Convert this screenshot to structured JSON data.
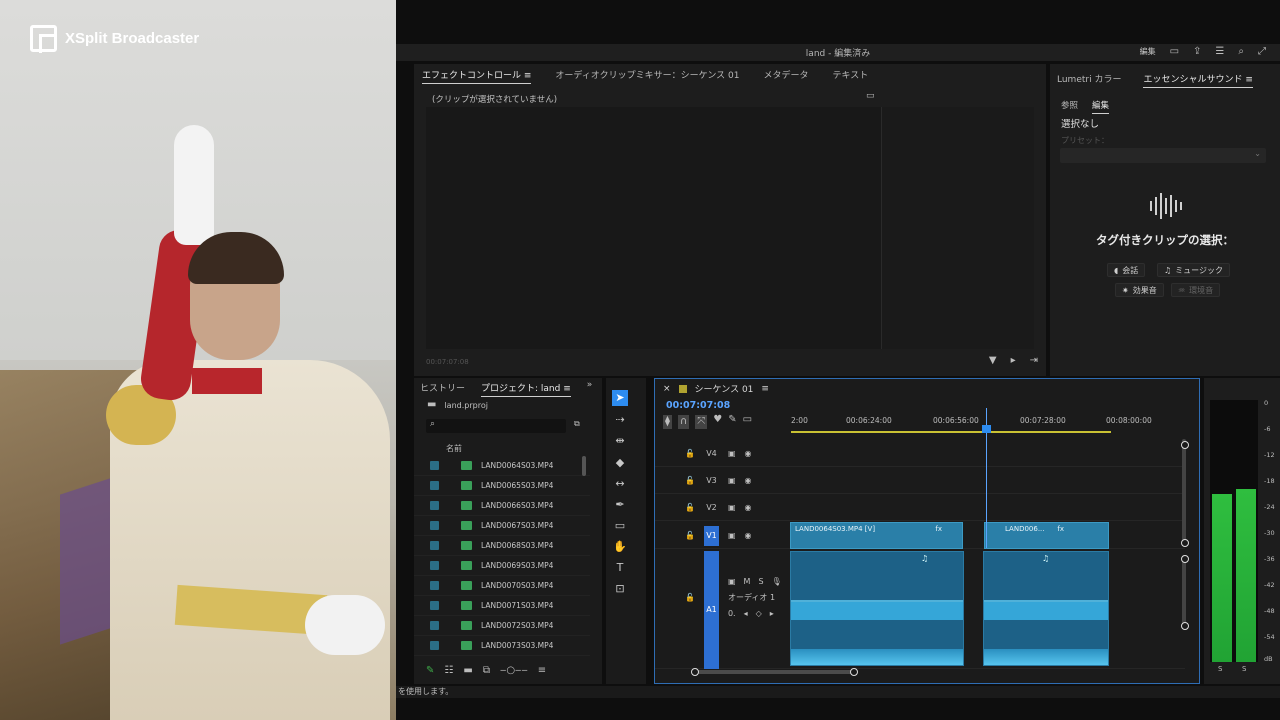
{
  "logo": {
    "text": "XSplit Broadcaster"
  },
  "titlebar": {
    "title": "land - 編集済み",
    "edit_label": "編集"
  },
  "effects_panel": {
    "tabs": [
      "エフェクトコントロール",
      "オーディオクリップミキサー：シーケンス 01",
      "メタデータ",
      "テキスト"
    ],
    "no_clip_text": "(クリップが選択されていません)",
    "timecode": "00:07:07:08"
  },
  "essential_sound": {
    "tabs": [
      "Lumetri カラー",
      "エッセンシャルサウンド"
    ],
    "subtabs": [
      "参照",
      "編集"
    ],
    "none_selected": "選択なし",
    "preset_label": "プリセット：",
    "choose_label": "タグ付きクリップの選択：",
    "buttons": [
      "会話",
      "ミュージック",
      "効果音",
      "環境音"
    ]
  },
  "project_panel": {
    "tabs": [
      "ヒストリー",
      "プロジェクト: land"
    ],
    "file": "land.prproj",
    "column_name": "名前",
    "items": [
      "LAND0064S03.MP4",
      "LAND0065S03.MP4",
      "LAND0066S03.MP4",
      "LAND0067S03.MP4",
      "LAND0068S03.MP4",
      "LAND0069S03.MP4",
      "LAND0070S03.MP4",
      "LAND0071S03.MP4",
      "LAND0072S03.MP4",
      "LAND0073S03.MP4"
    ]
  },
  "timeline": {
    "sequence_tab": "シーケンス 01",
    "timecode": "00:07:07:08",
    "ruler": [
      "2:00",
      "00:06:24:00",
      "00:06:56:00",
      "00:07:28:00",
      "00:08:00:00"
    ],
    "tracks": {
      "v4": "V4",
      "v3": "V3",
      "v2": "V2",
      "v1": "V1",
      "a1": "A1"
    },
    "audio_track_name": "オーディオ 1",
    "clips": {
      "v1a": "LAND0064S03.MP4 [V]",
      "v1b": "LAND006...",
      "fx": "fx"
    },
    "audio_controls": {
      "m": "M",
      "s": "S",
      "vol": "0."
    }
  },
  "meters": {
    "scale": [
      "0",
      "-6",
      "-12",
      "-18",
      "-24",
      "-30",
      "-36",
      "-42",
      "-48",
      "-54",
      "dB"
    ],
    "ch": [
      "S",
      "S"
    ],
    "levels": [
      0.64,
      0.66
    ]
  },
  "status": {
    "text": "を使用します。"
  }
}
